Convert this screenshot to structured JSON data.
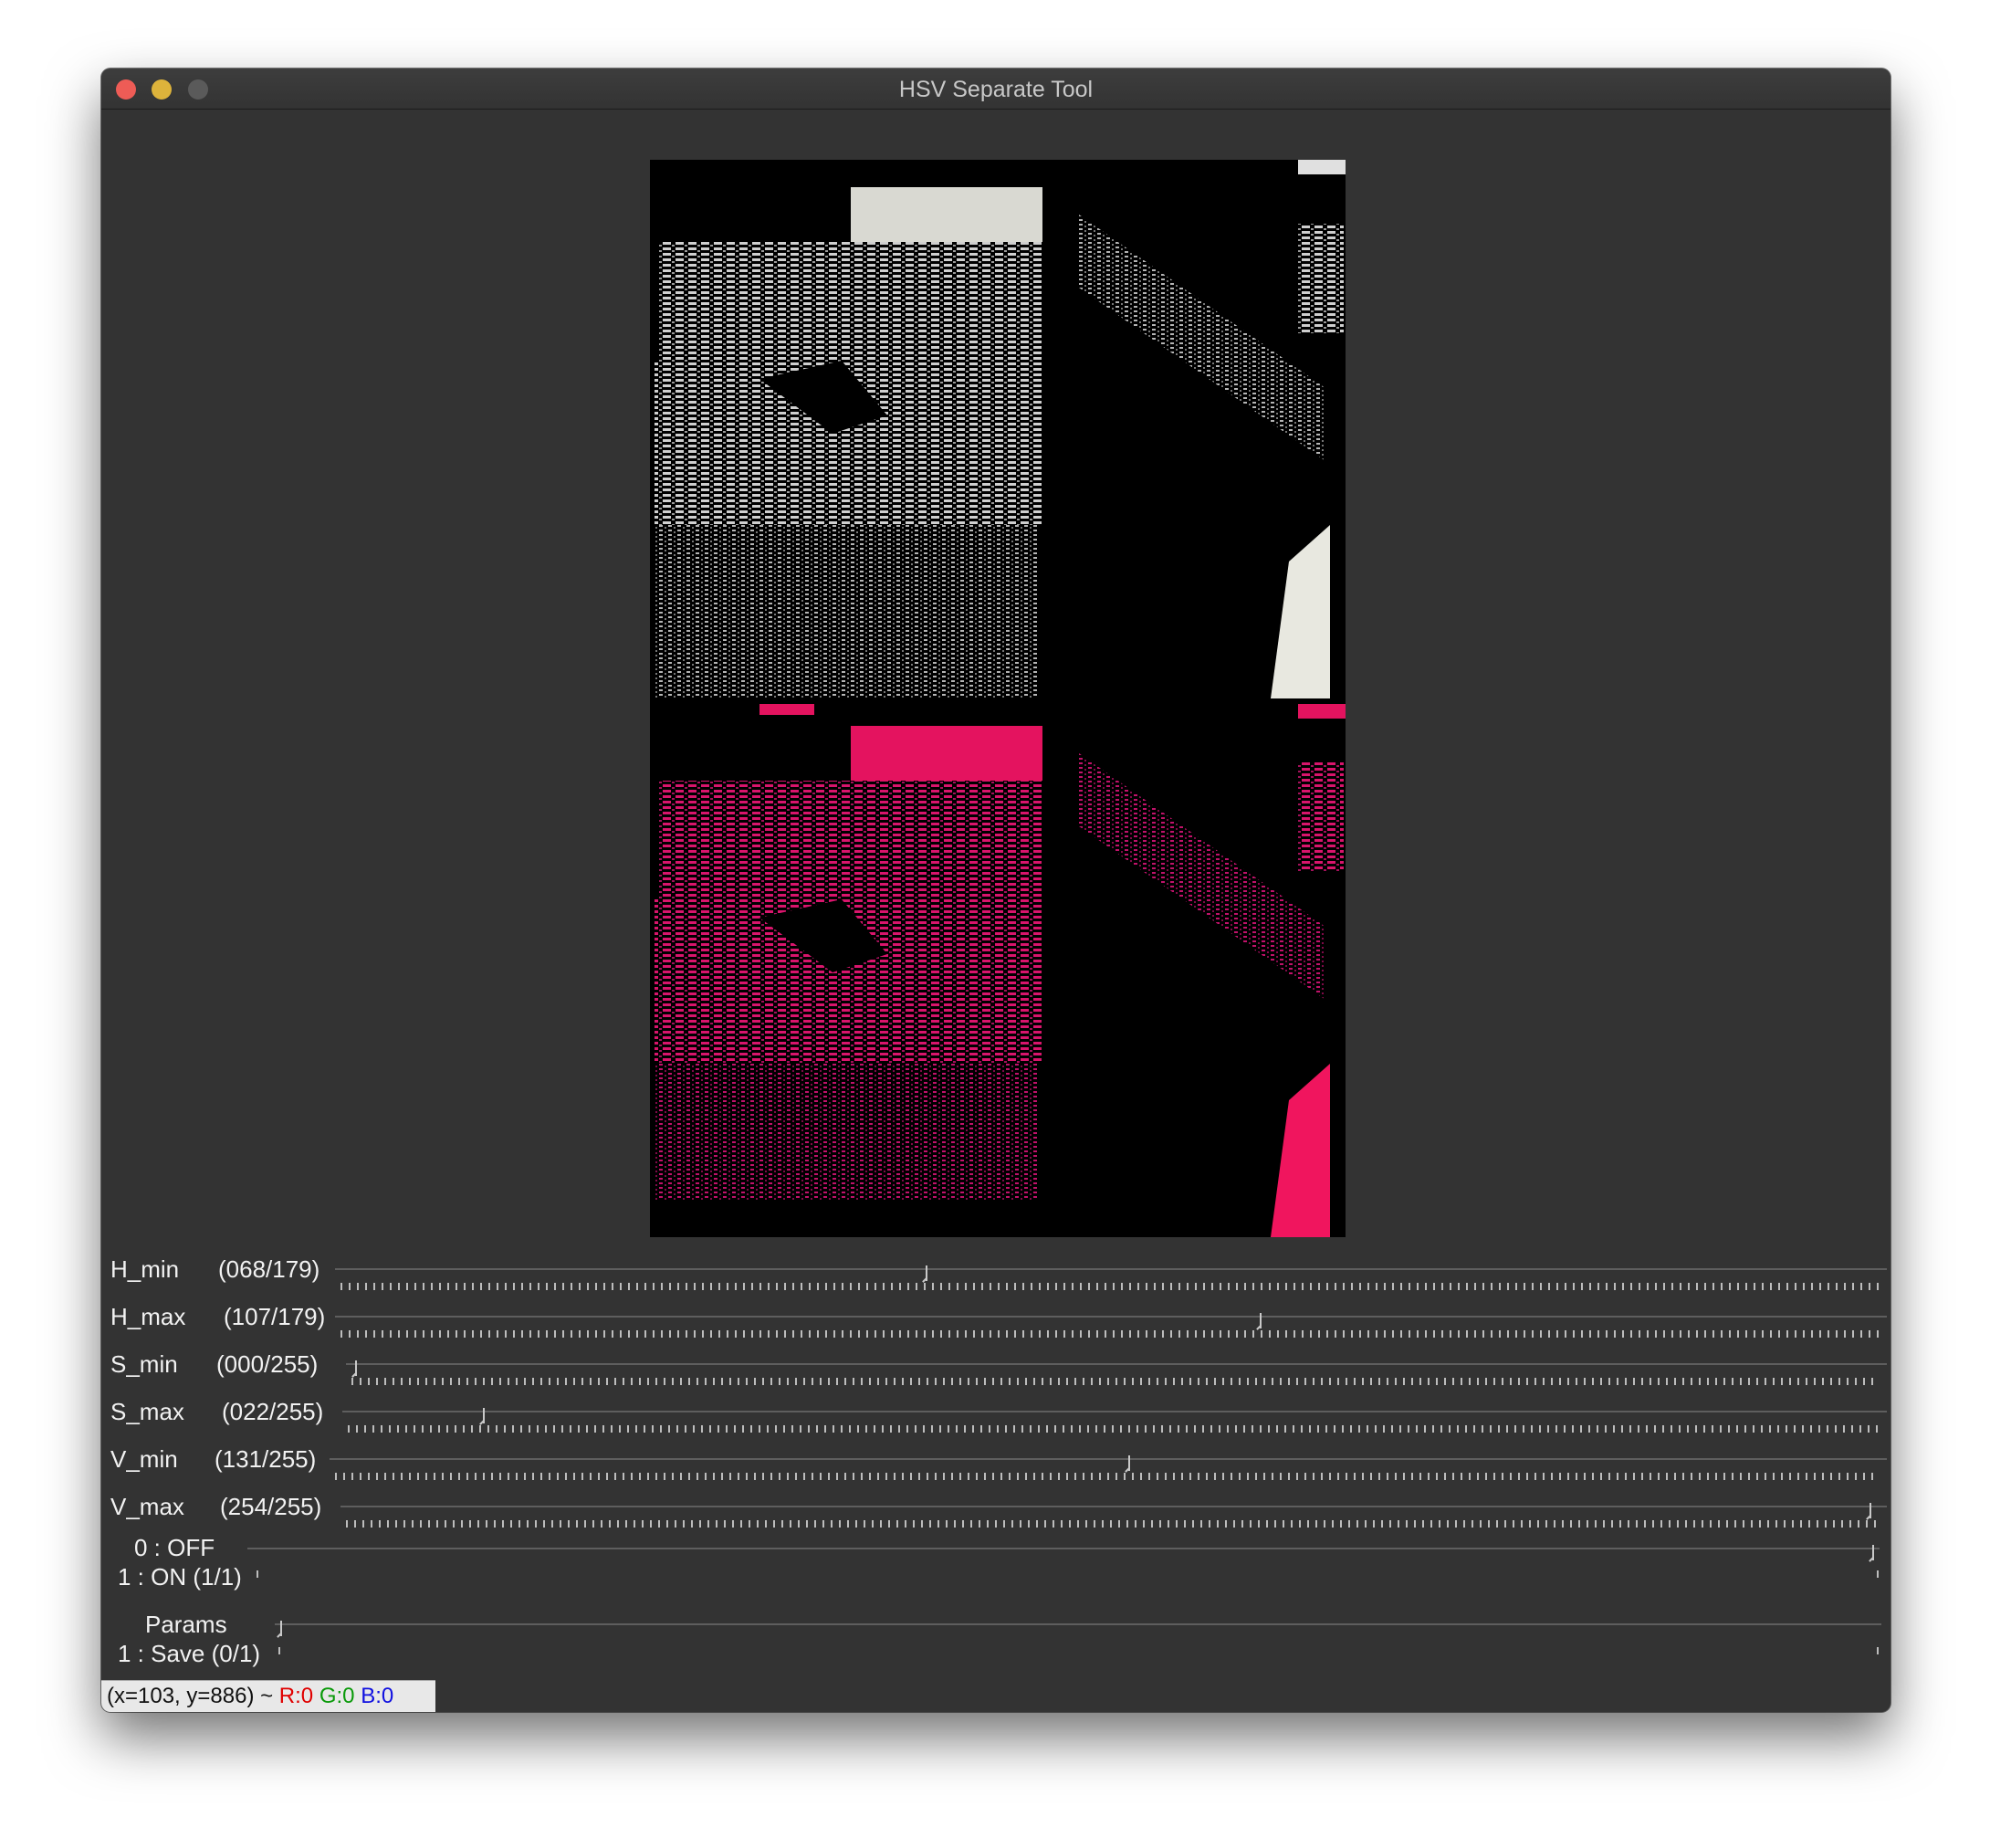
{
  "window": {
    "title": "HSV Separate Tool"
  },
  "trackbars": [
    {
      "name": "H_min",
      "count": "(068/179)",
      "value": 68,
      "max": 179
    },
    {
      "name": "H_max",
      "count": "(107/179)",
      "value": 107,
      "max": 179
    },
    {
      "name": "S_min",
      "count": "(000/255)",
      "value": 0,
      "max": 255
    },
    {
      "name": "S_max",
      "count": "(022/255)",
      "value": 22,
      "max": 255
    },
    {
      "name": "V_min",
      "count": "(131/255)",
      "value": 131,
      "max": 255
    },
    {
      "name": "V_max",
      "count": "(254/255)",
      "value": 254,
      "max": 255
    }
  ],
  "toggle": {
    "line1": "0 : OFF",
    "line2": "1 : ON (1/1)",
    "value": 1,
    "max": 1
  },
  "params": {
    "line1": "Params",
    "line2": "1 : Save (0/1)",
    "value": 0,
    "max": 1
  },
  "status": {
    "coords": "(x=103, y=886) ~ ",
    "r": "R:0",
    "g": "G:0",
    "b": "B:0",
    "colors": {
      "r": "#e00000",
      "g": "#0a9a0a",
      "b": "#1010e0"
    }
  },
  "image": {
    "description_icon": "hsv-mask-preview"
  }
}
